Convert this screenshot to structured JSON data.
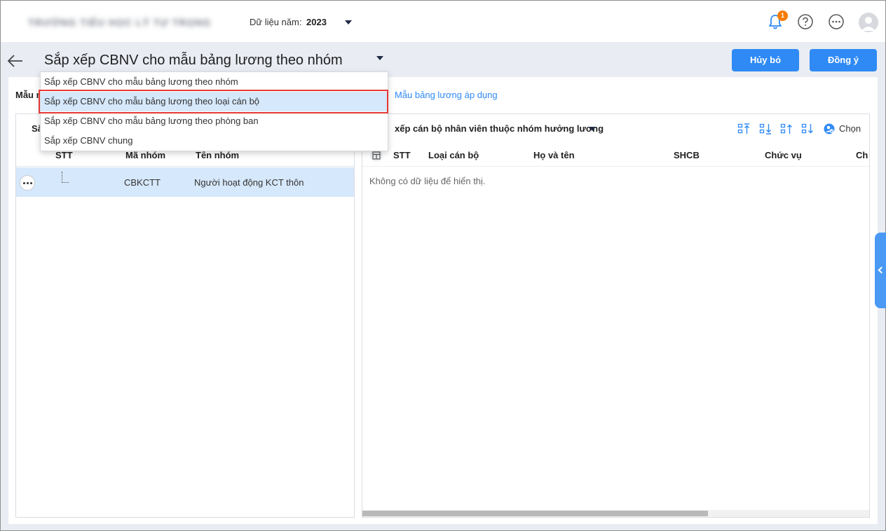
{
  "header": {
    "org_name": "TRƯỜNG TIỂU HỌC LÝ TỰ TRỌNG",
    "year_label": "Dữ liệu năm:",
    "year_value": "2023",
    "notification_count": "1"
  },
  "title_bar": {
    "title": "Sắp xếp CBNV cho mẫu bảng lương theo nhóm",
    "cancel_label": "Hủy bỏ",
    "ok_label": "Đồng ý"
  },
  "dropdown": {
    "items": [
      "Sắp xếp CBNV cho mẫu bảng lương theo nhóm",
      "Sắp xếp CBNV cho mẫu bảng lương theo loại cán bộ",
      "Sắp xếp CBNV cho mẫu bảng lương theo phòng ban",
      "Sắp xếp CBNV chung"
    ],
    "highlighted_index": 1
  },
  "content": {
    "mau_label": "Mẫu n",
    "mau_link": "Mẫu bảng lương áp dụng"
  },
  "left_panel": {
    "tab_label": "Sắ",
    "columns": [
      "STT",
      "Mã nhóm",
      "Tên nhóm"
    ],
    "rows": [
      {
        "code": "CBKCTT",
        "name": "Người hoạt động KCT thôn"
      }
    ]
  },
  "right_panel": {
    "title": "xếp cán bộ nhân viên thuộc nhóm hưởng lương",
    "choose_label": "Chọn",
    "columns": [
      "STT",
      "Loại cán bộ",
      "Họ và tên",
      "SHCB",
      "Chức vụ",
      "Chu"
    ],
    "empty_message": "Không có dữ liệu để hiển thị."
  },
  "colors": {
    "accent": "#2f8af5",
    "selected_row": "#d6e8fb",
    "highlight_border": "#e53935",
    "badge": "#f57c00"
  },
  "icons": [
    "bell-icon",
    "help-icon",
    "more-horizontal-icon",
    "avatar-icon",
    "back-arrow-icon",
    "move-top-icon",
    "move-bottom-icon",
    "move-up-icon",
    "move-down-icon",
    "person-check-icon",
    "grid-settings-icon",
    "chevron-left-icon"
  ]
}
